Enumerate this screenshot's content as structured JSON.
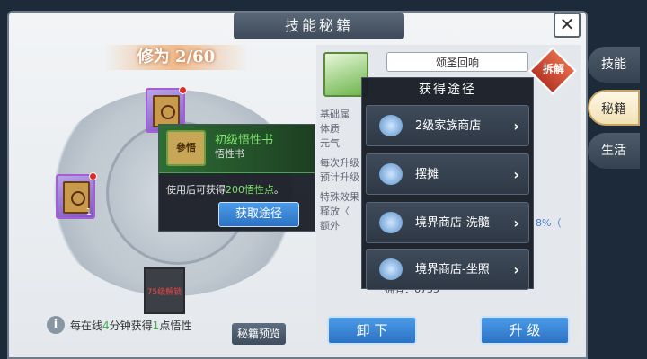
{
  "window": {
    "title": "技能秘籍",
    "close_glyph": "✕"
  },
  "left": {
    "cultivation": "修为 2/60",
    "locked_slot_text": "75级解锁",
    "slot_count": "1",
    "info_text_prefix": "每在线",
    "info_highlight_1": "4",
    "info_text_mid": "分钟获得",
    "info_highlight_2": "1",
    "info_text_suffix": "点悟性",
    "preview_button": "秘籍预览"
  },
  "right": {
    "skill_name": "颂圣回响",
    "dismantle": "拆解",
    "info_lines": [
      "基础属",
      "体质",
      "元气",
      "每次升级",
      "预计升级",
      "特殊效果",
      "释放〈",
      "额外"
    ],
    "hint_numbers": [
      "8%（"
    ],
    "owned_label": "拥有：",
    "owned_value": "6755",
    "unequip_button": "卸 下",
    "upgrade_button": "升 级"
  },
  "side_tabs": [
    {
      "label": "技能",
      "active": false
    },
    {
      "label": "秘籍",
      "active": true
    },
    {
      "label": "生活",
      "active": false
    }
  ],
  "book_tooltip": {
    "title": "初级悟性书",
    "subtitle": "悟性书",
    "thumb_text": "參悟",
    "desc_prefix": "使用后可获得",
    "desc_highlight": "200悟性点",
    "desc_suffix": "。",
    "get_path_button": "获取途径"
  },
  "source_popup": {
    "title": "获得途径",
    "items": [
      {
        "label": "2级家族商店",
        "arrow": "›"
      },
      {
        "label": "摆摊",
        "arrow": "›"
      },
      {
        "label": "境界商店-洗髓",
        "arrow": "›"
      },
      {
        "label": "境界商店-坐照",
        "arrow": "›"
      }
    ]
  }
}
